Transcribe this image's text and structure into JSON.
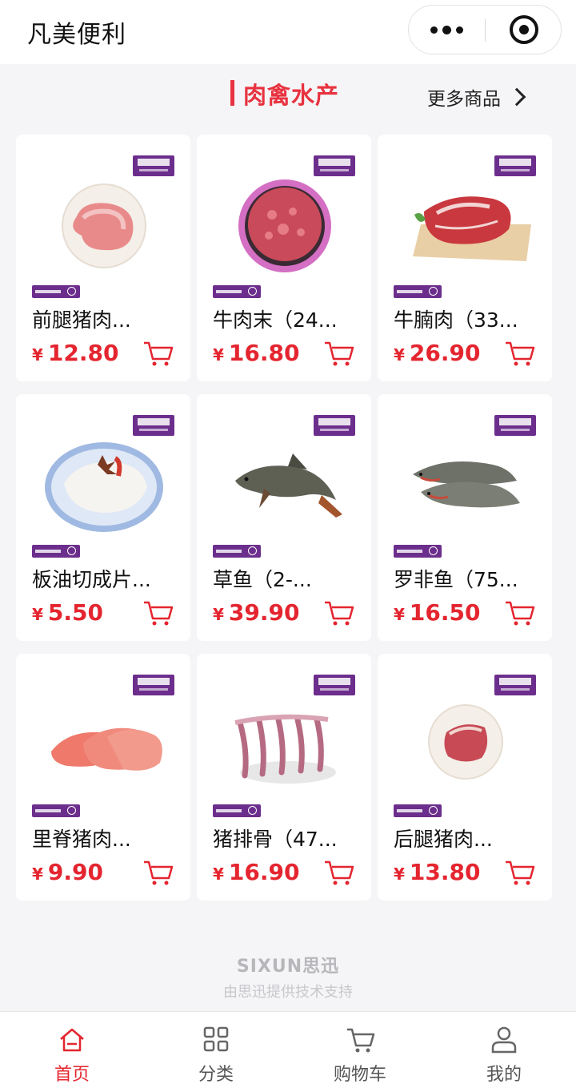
{
  "app": {
    "title": "凡美便利"
  },
  "section": {
    "title": "肉禽水产",
    "more_label": "更多商品"
  },
  "products": [
    {
      "name": "前腿猪肉...",
      "currency": "¥",
      "price": "12.80",
      "image": "pork-foreleg"
    },
    {
      "name": "牛肉末（24...",
      "currency": "¥",
      "price": "16.80",
      "image": "minced-beef"
    },
    {
      "name": "牛腩肉（33...",
      "currency": "¥",
      "price": "26.90",
      "image": "beef-brisket"
    },
    {
      "name": "板油切成片...",
      "currency": "¥",
      "price": "5.50",
      "image": "pork-fat-slices"
    },
    {
      "name": "草鱼（2-...",
      "currency": "¥",
      "price": "39.90",
      "image": "grass-carp"
    },
    {
      "name": "罗非鱼（75...",
      "currency": "¥",
      "price": "16.50",
      "image": "tilapia"
    },
    {
      "name": "里脊猪肉...",
      "currency": "¥",
      "price": "9.90",
      "image": "pork-tenderloin"
    },
    {
      "name": "猪排骨（47...",
      "currency": "¥",
      "price": "16.90",
      "image": "pork-ribs"
    },
    {
      "name": "后腿猪肉...",
      "currency": "¥",
      "price": "13.80",
      "image": "pork-hindleg"
    }
  ],
  "footer": {
    "brand": "SIXUN思迅",
    "note": "由思迅提供技术支持"
  },
  "tabs": [
    {
      "label": "首页",
      "icon": "home-icon",
      "active": true
    },
    {
      "label": "分类",
      "icon": "grid-icon",
      "active": false
    },
    {
      "label": "购物车",
      "icon": "cart-icon",
      "active": false
    },
    {
      "label": "我的",
      "icon": "user-icon",
      "active": false
    }
  ],
  "colors": {
    "accent": "#e4252f",
    "brand_purple": "#6c2e8c"
  }
}
